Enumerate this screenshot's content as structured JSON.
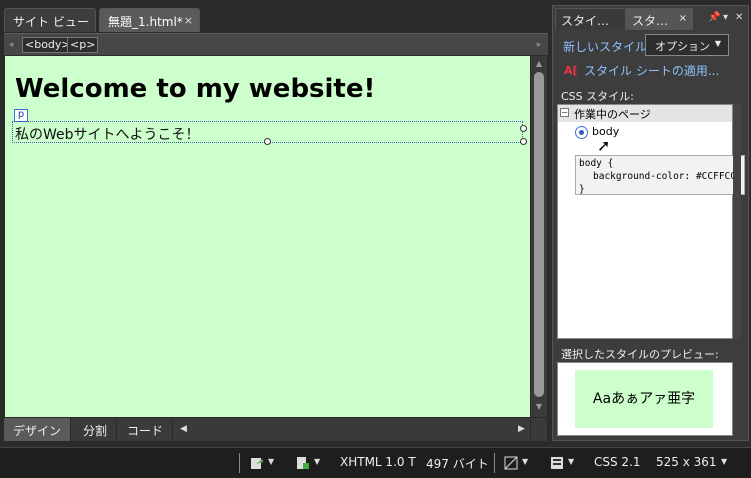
{
  "document_tabs": [
    {
      "label": "サイト ビュー",
      "active": false
    },
    {
      "label": "無題_1.html*",
      "active": true,
      "close": "×"
    }
  ],
  "tag_selector": {
    "tags": [
      "<body>",
      "<p>"
    ]
  },
  "canvas": {
    "background": "#CCFFCC",
    "heading": "Welcome to my website!",
    "p_tag_label": "p",
    "paragraph": "私のWebサイトへようこそ！"
  },
  "view_bar": {
    "buttons": [
      "デザイン",
      "分割",
      "コード"
    ],
    "active": "デザイン"
  },
  "panel": {
    "tabs": [
      {
        "label": "スタイ…"
      },
      {
        "label": "スタ…",
        "close": "×"
      }
    ],
    "new_style_link": "新しいスタイル...",
    "options_button": "オプション",
    "apply_stylesheet_link": "スタイル シートの適用...",
    "css_styles_label": "CSS スタイル:",
    "tree": {
      "group_label": "作業中のページ",
      "toggle": "⊟",
      "item_label": "body"
    },
    "tooltip": {
      "line1": "body {",
      "line2": "background-color: #CCFFCC;",
      "line3": "}"
    },
    "preview_label": "選択したスタイルのプレビュー:",
    "preview_text": "Aaあぁアァ亜字"
  },
  "status_bar": {
    "doctype": "XHTML 1.0 T",
    "size": "497 バイト",
    "css_level": "CSS 2.1",
    "dimensions": "525 x 361"
  },
  "colors": {
    "accent_link": "#8fc1ff",
    "canvas_bg": "#CCFFCC",
    "chrome_dark": "#2b2b2b"
  }
}
